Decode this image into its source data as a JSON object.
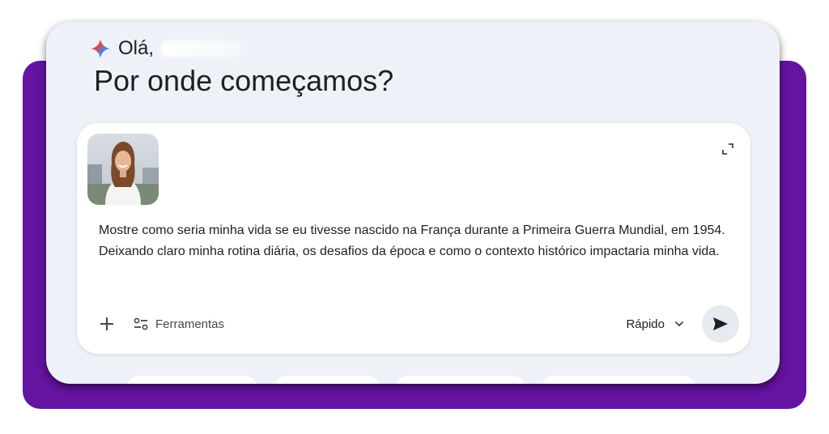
{
  "greeting": {
    "text": "Olá,"
  },
  "headline": "Por onde começamos?",
  "composer": {
    "prompt": "Mostre como seria minha vida se eu tivesse nascido na França durante a Primeira Guerra Mundial, em 1954. Deixando claro minha rotina diária, os desafios da época e como o contexto histórico impactaria minha vida.",
    "tools_label": "Ferramentas",
    "model_label": "Rápido",
    "icons": {
      "add": "plus-icon",
      "tools": "tools-icon",
      "model_dropdown": "chevron-down-icon",
      "send": "send-icon",
      "expand": "expand-icon",
      "greeting": "gemini-sparkle-icon"
    }
  },
  "colors": {
    "frame": "#6414a0",
    "window_bg": "#eef1f7",
    "composer_bg": "#ffffff",
    "text": "#1f1f1f",
    "send_bg": "#e6eaf1"
  }
}
